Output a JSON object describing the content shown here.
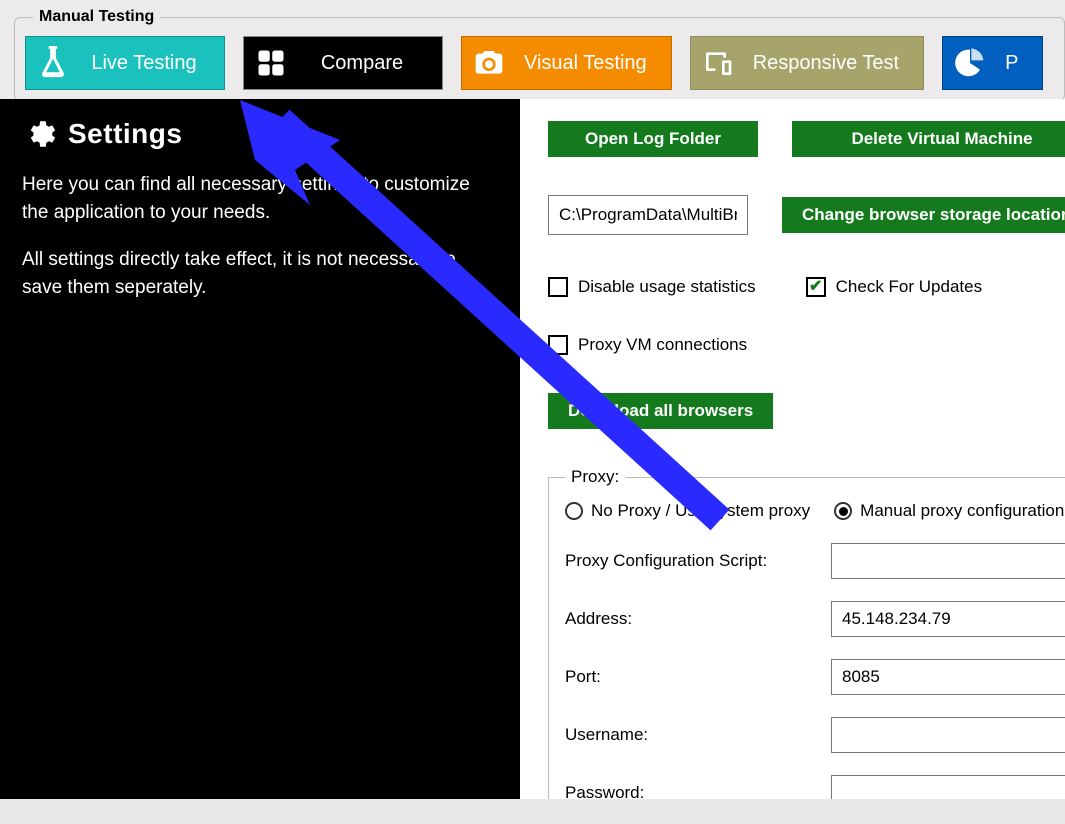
{
  "group_label": "Manual Testing",
  "tabs": {
    "live": "Live Testing",
    "compare": "Compare",
    "visual": "Visual Testing",
    "responsive": "Responsive Test",
    "pie_partial": "P"
  },
  "sidebar": {
    "title": "Settings",
    "para1": "Here you can find all necessary settings to customize the application to your needs.",
    "para2": "All settings directly take effect, it is not necessary to save them seperately."
  },
  "buttons": {
    "open_log": "Open Log Folder",
    "delete_vm": "Delete Virtual Machine",
    "change_storage": "Change browser storage location",
    "download_all": "Download all browsers"
  },
  "path_value": "C:\\ProgramData\\MultiBro",
  "checks": {
    "disable_stats": "Disable usage statistics",
    "check_updates": "Check For Updates",
    "proxy_vm": "Proxy VM connections"
  },
  "proxy": {
    "legend": "Proxy:",
    "no_proxy": "No Proxy / Use system proxy",
    "manual_proxy": "Manual proxy configuration",
    "config_script_label": "Proxy Configuration Script:",
    "config_script_value": "",
    "address_label": "Address:",
    "address_value": "45.148.234.79",
    "port_label": "Port:",
    "port_value": "8085",
    "username_label": "Username:",
    "username_value": "",
    "password_label": "Password:",
    "password_value": ""
  }
}
